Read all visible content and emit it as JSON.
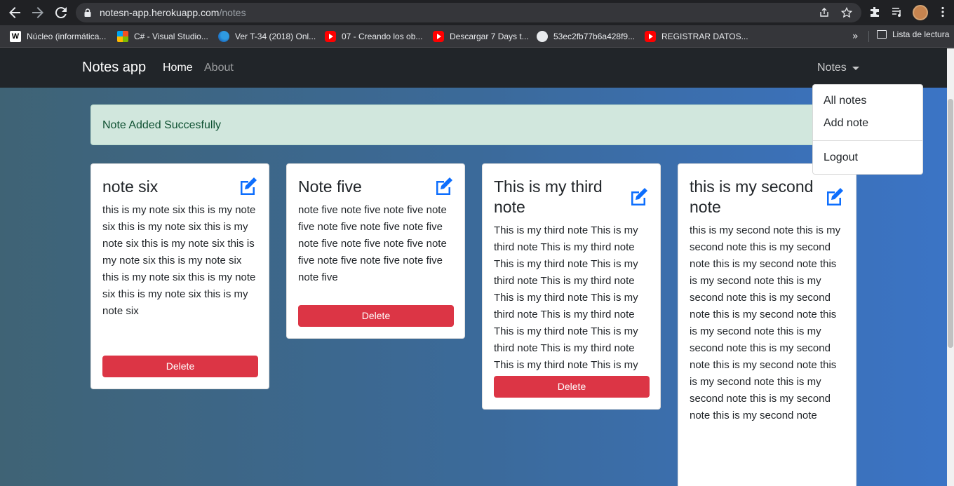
{
  "browser": {
    "url_host": "notesn-app.herokuapp.com",
    "url_path": "/notes",
    "bookmarks": [
      {
        "label": "Núcleo (informática...",
        "icon": "wikipedia-icon"
      },
      {
        "label": "C# - Visual Studio...",
        "icon": "microsoft-icon"
      },
      {
        "label": "Ver T-34 (2018) Onl...",
        "icon": "edge-icon"
      },
      {
        "label": "07 - Creando los ob...",
        "icon": "youtube-icon"
      },
      {
        "label": "Descargar 7 Days t...",
        "icon": "youtube-icon"
      },
      {
        "label": "53ec2fb77b6a428f9...",
        "icon": "globe-icon"
      },
      {
        "label": "REGISTRAR DATOS...",
        "icon": "youtube-icon"
      }
    ],
    "more_label": "»",
    "reading_list_label": "Lista de lectura"
  },
  "navbar": {
    "brand": "Notes app",
    "home": "Home",
    "about": "About",
    "notes_menu": "Notes"
  },
  "dropdown": {
    "items": [
      "All notes",
      "Add note",
      "Logout"
    ]
  },
  "alert": {
    "message": "Note Added Succesfully"
  },
  "notes": [
    {
      "title": "note six",
      "body": "this is my note six this is my note six this is my note six this is my note six this is my note six this is my note six this is my note six this is my note six this is my note six this is my note six this is my note six",
      "delete_label": "Delete"
    },
    {
      "title": "Note five",
      "body": "note five note five note five note five note five note five note five note five note five note five note five note five note five note five note five",
      "delete_label": "Delete"
    },
    {
      "title": "This is my third note",
      "body": "This is my third note This is my third note This is my third note This is my third note This is my third note This is my third note This is my third note This is my third note This is my third note This is my third note This is my third note This is my third note This is my third note This is my third note",
      "delete_label": "Delete"
    },
    {
      "title": "this is my second note",
      "body": "this is my second note this is my second note this is my second note this is my second note this is my second note this is my second note this is my second note this is my second note this is my second note this is my second note this is my second note this is my second note this is my second note this is my second note this is my second note this is my second note",
      "delete_label": ""
    }
  ],
  "colors": {
    "navbar": "#212529",
    "alert_bg": "#d1e7dd",
    "alert_text": "#0f5132",
    "danger": "#dc3545",
    "edit_icon": "#0d6efd"
  }
}
